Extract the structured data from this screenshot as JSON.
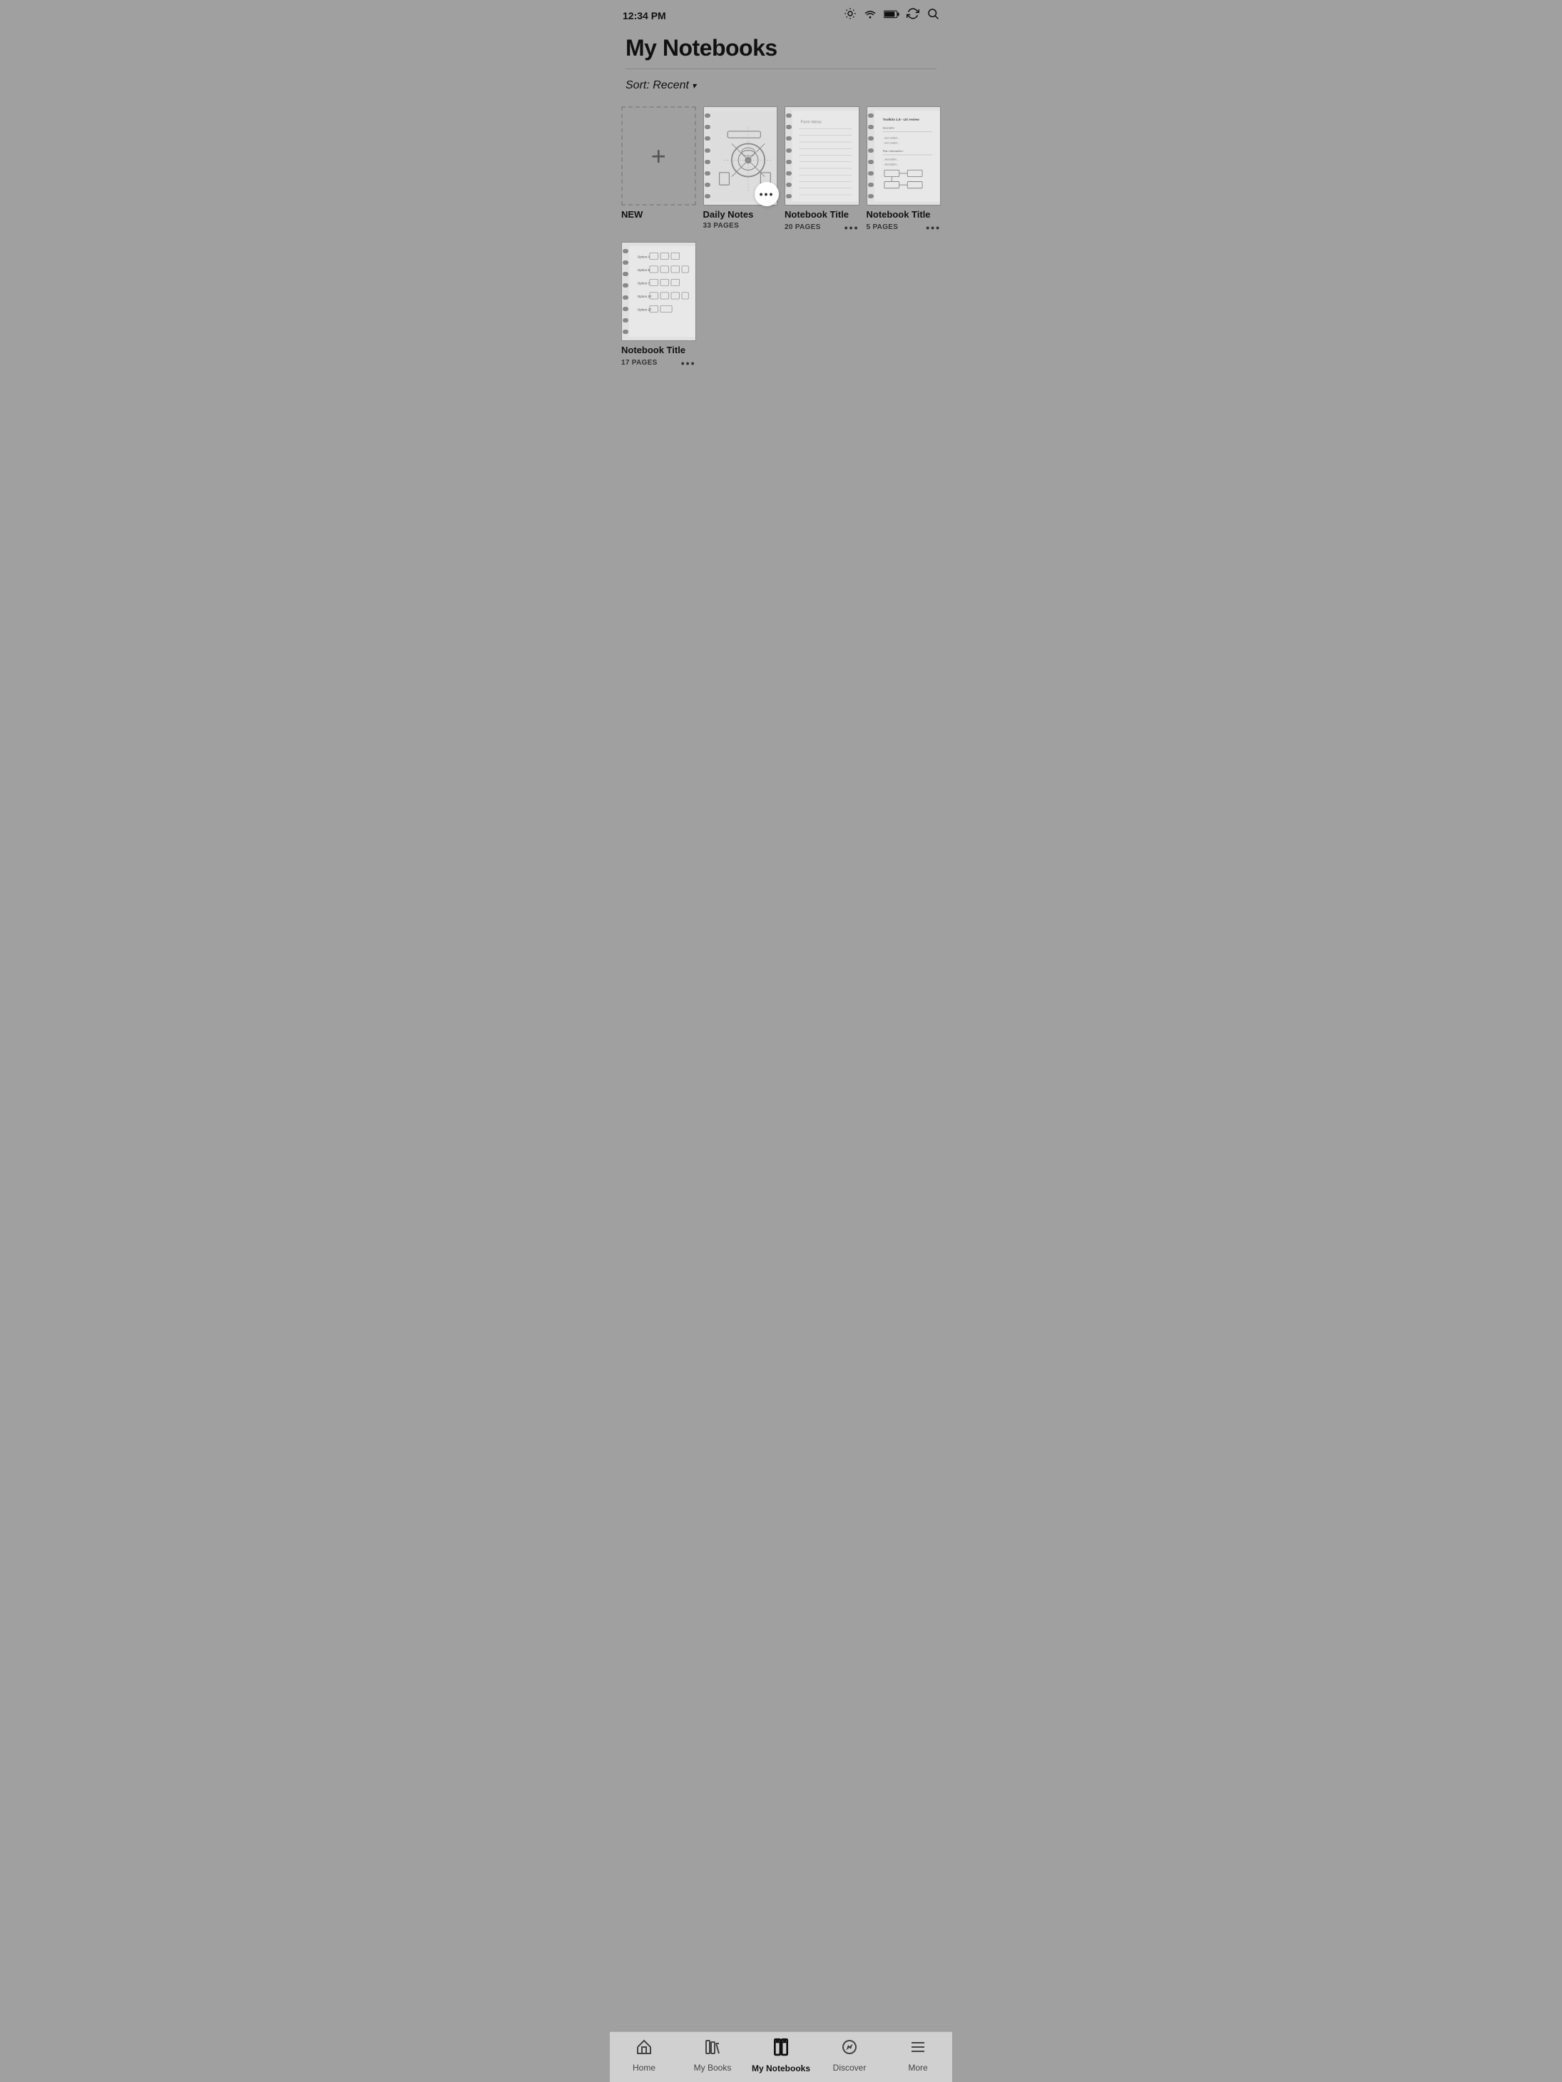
{
  "statusBar": {
    "time": "12:34 PM"
  },
  "header": {
    "title": "My Notebooks"
  },
  "sort": {
    "label": "Sort: Recent",
    "chevron": "▾"
  },
  "notebooks": [
    {
      "id": "new",
      "type": "new",
      "label": "NEW"
    },
    {
      "id": "daily-notes",
      "type": "notebook",
      "name": "Daily Notes",
      "pages": "33 PAGES",
      "hasMoreCircle": true
    },
    {
      "id": "notebook-2",
      "type": "notebook",
      "name": "Notebook Title",
      "pages": "20 PAGES"
    },
    {
      "id": "notebook-3",
      "type": "notebook",
      "name": "Notebook Title",
      "pages": "5 PAGES"
    },
    {
      "id": "notebook-4",
      "type": "notebook",
      "name": "Notebook Title",
      "pages": "17 PAGES"
    }
  ],
  "bottomNav": [
    {
      "id": "home",
      "icon": "home",
      "label": "Home",
      "active": false
    },
    {
      "id": "my-books",
      "icon": "books",
      "label": "My Books",
      "active": false
    },
    {
      "id": "my-notebooks",
      "icon": "notebooks",
      "label": "My Notebooks",
      "active": true
    },
    {
      "id": "discover",
      "icon": "discover",
      "label": "Discover",
      "active": false
    },
    {
      "id": "more",
      "icon": "more",
      "label": "More",
      "active": false
    }
  ]
}
